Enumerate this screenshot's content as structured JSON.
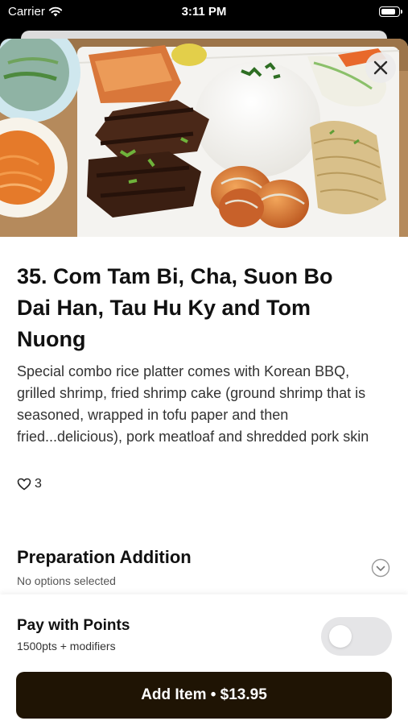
{
  "status_bar": {
    "carrier": "Carrier",
    "time": "3:11 PM",
    "battery_level": 0.9
  },
  "item": {
    "title": "35. Com Tam Bi, Cha, Suon Bo Dai Han, Tau Hu Ky and Tom Nuong",
    "description": "Special combo rice platter comes with Korean BBQ, grilled shrimp, fried shrimp cake (ground shrimp that is seasoned, wrapped in tofu paper and then fried...delicious), pork meatloaf and shredded pork skin",
    "likes": "3"
  },
  "preparation": {
    "title": "Preparation Addition",
    "subtitle": "No options selected"
  },
  "points": {
    "title": "Pay with Points",
    "subtitle": "1500pts + modifiers",
    "enabled": false
  },
  "add_button": {
    "label": "Add Item • $13.95"
  },
  "icons": {
    "close": "close-icon",
    "heart": "heart-icon",
    "chevron": "chevron-down-icon",
    "wifi": "wifi-icon",
    "battery": "battery-icon"
  },
  "colors": {
    "add_button_bg": "#1f1404",
    "toggle_off": "#e5e5e7"
  }
}
